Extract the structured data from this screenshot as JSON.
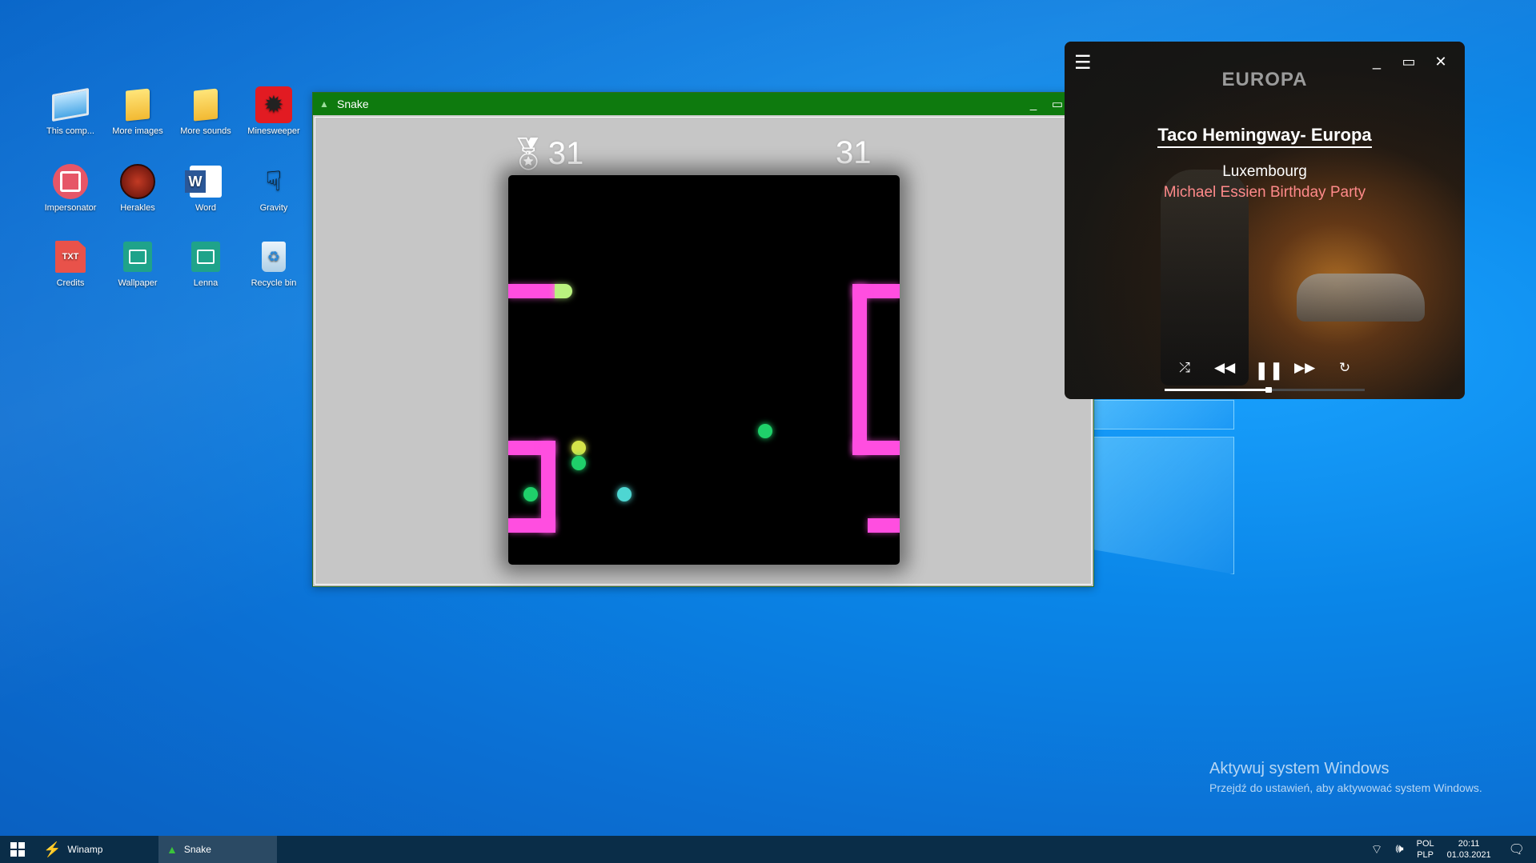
{
  "desktop": {
    "icons": [
      {
        "label": "This comp...",
        "icon": "computer-icon"
      },
      {
        "label": "More images",
        "icon": "folder-icon"
      },
      {
        "label": "More sounds",
        "icon": "folder-icon"
      },
      {
        "label": "Minesweeper",
        "icon": "mine-icon"
      },
      {
        "label": "Impersonator",
        "icon": "impersonator-icon"
      },
      {
        "label": "Herakles",
        "icon": "herakles-icon"
      },
      {
        "label": "Word",
        "icon": "word-icon"
      },
      {
        "label": "Gravity",
        "icon": "gravity-icon"
      },
      {
        "label": "Credits",
        "icon": "txt-file-icon"
      },
      {
        "label": "Wallpaper",
        "icon": "image-file-icon"
      },
      {
        "label": "Lenna",
        "icon": "image-file-icon"
      },
      {
        "label": "Recycle bin",
        "icon": "recycle-bin-icon"
      }
    ],
    "txt_badge": "TXT"
  },
  "snake": {
    "title": "Snake",
    "score_left": "31",
    "score_right": "31",
    "colors": {
      "snake": "#ff4ee0",
      "head": "#b9f27f",
      "green_dot": "#1fd06a",
      "yellow_dot": "#d5e34a",
      "cyan_dot": "#4ed6d2",
      "board": "#000000"
    }
  },
  "player": {
    "logo": "EUROPA",
    "title": "Taco Hemingway- Europa",
    "artist": "Luxembourg",
    "album": "Michael Essien Birthday Party",
    "progress": 0.52,
    "accent": "#ff8a8a"
  },
  "watermark": {
    "line1": "Aktywuj system Windows",
    "line2": "Przejdź do ustawień, aby aktywować system Windows."
  },
  "taskbar": {
    "apps": [
      {
        "label": "Winamp",
        "icon": "winamp-icon",
        "active": false
      },
      {
        "label": "Snake",
        "icon": "snake-icon",
        "active": true
      }
    ],
    "lang_top": "POL",
    "lang_bottom": "PLP",
    "time": "20:11",
    "date": "01.03.2021"
  }
}
